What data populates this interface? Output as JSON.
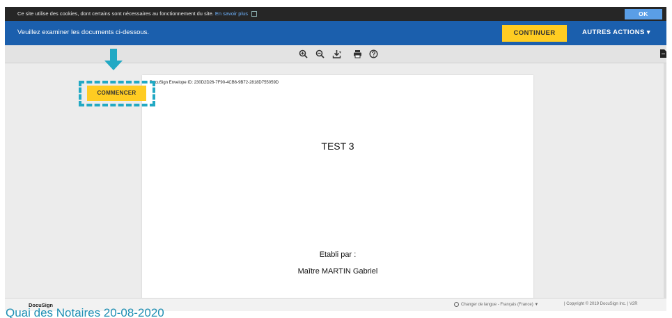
{
  "cookie_bar": {
    "text": "Ce site utilise des cookies, dont certains sont nécessaires au fonctionnement du site.",
    "link": "En savoir plus",
    "ok_label": "OK"
  },
  "action_bar": {
    "message": "Veuillez examiner les documents ci-dessous.",
    "continue_label": "CONTINUER",
    "other_actions_label": "AUTRES ACTIONS ▾"
  },
  "toolbar": {
    "icons": [
      "zoom-in-icon",
      "zoom-out-icon",
      "download-icon",
      "print-icon",
      "help-icon"
    ],
    "download_caret": "▾"
  },
  "start_button": {
    "label": "COMMENCER"
  },
  "document": {
    "envelope_id": "DocuSign Envelope ID: 230D2D26-7F90-4CB6-9B72-2818D755059D",
    "title": "TEST 3",
    "line1": "Etabli par :",
    "line2": "Maître MARTIN Gabriel"
  },
  "footer": {
    "brand": "DocuSign",
    "language": "Changer de langue - Français (France) ▼",
    "copyright": "| Copyright © 2019 DocuSign Inc. | V2R"
  },
  "caption": {
    "text": "Quai des Notaires 20-08-2020"
  },
  "colors": {
    "action_bar": "#1b5fad",
    "accent_yellow": "#ffcc22",
    "highlight_teal": "#22a9c4",
    "cookie_bar": "#262626"
  }
}
